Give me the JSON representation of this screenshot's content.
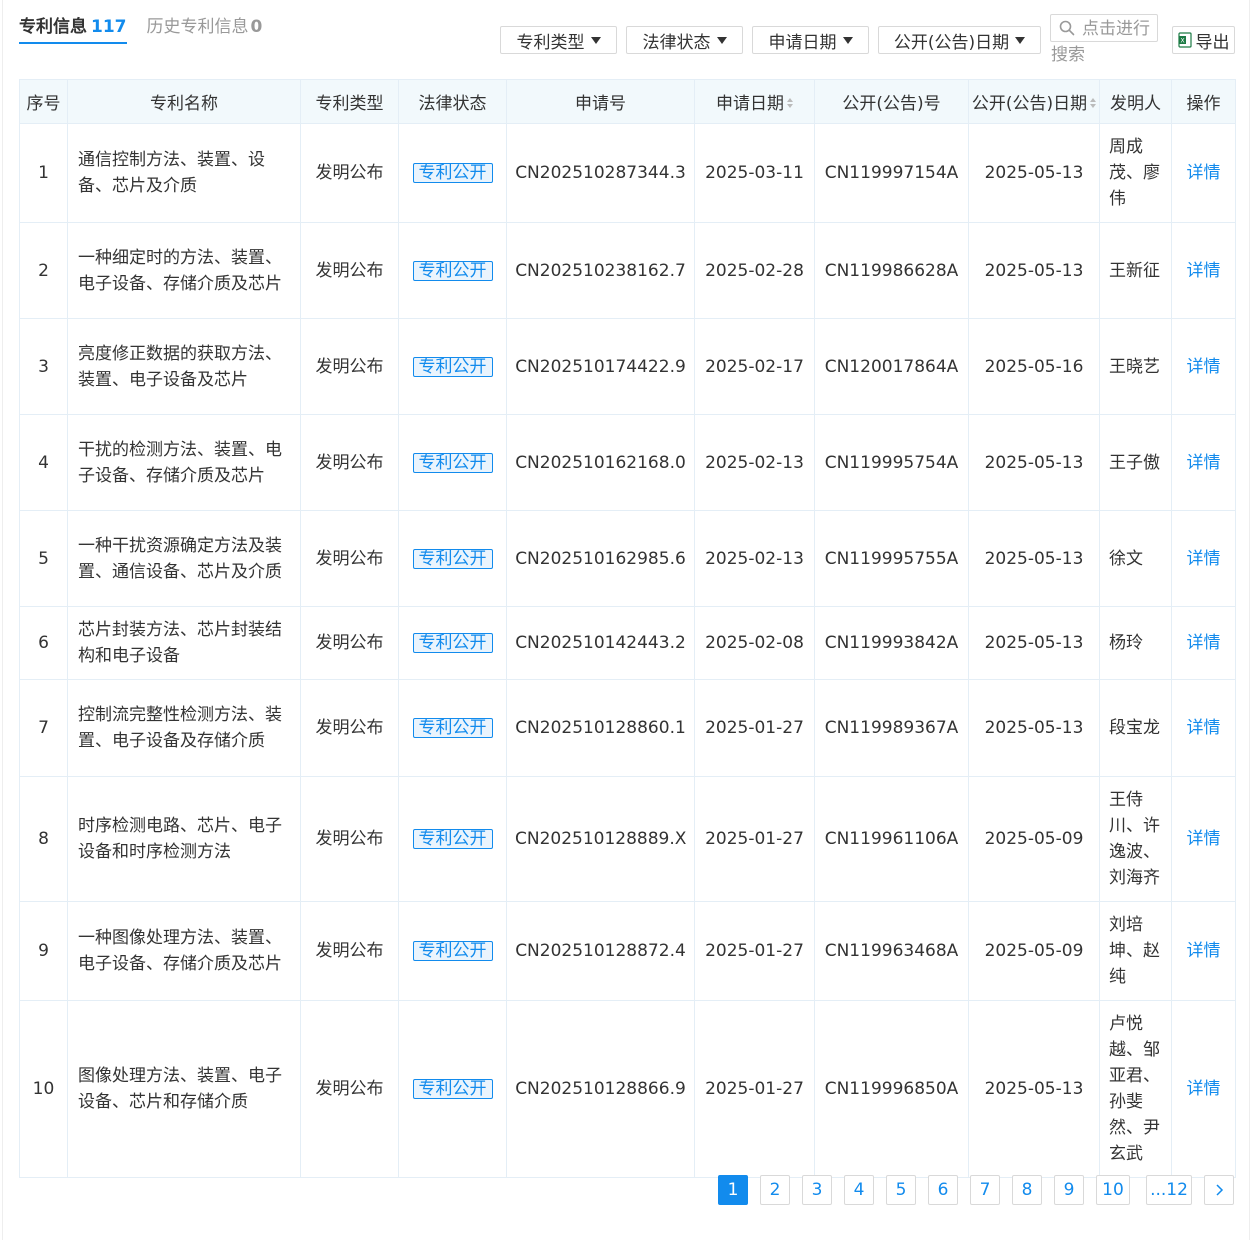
{
  "tabs": {
    "active": {
      "label": "专利信息",
      "count": "117"
    },
    "history": {
      "label": "历史专利信息",
      "count": "0"
    }
  },
  "filters": {
    "patent_type": "专利类型",
    "legal_status": "法律状态",
    "apply_date": "申请日期",
    "pub_date": "公开(公告)日期"
  },
  "search": {
    "line1": "点击进行",
    "line2": "搜索"
  },
  "export_label": "导出",
  "columns": {
    "index": "序号",
    "name": "专利名称",
    "type": "专利类型",
    "status": "法律状态",
    "app_no": "申请号",
    "app_date": "申请日期",
    "pub_no": "公开(公告)号",
    "pub_date": "公开(公告)日期",
    "inventor": "发明人",
    "action": "操作"
  },
  "rows": [
    {
      "index": "1",
      "name": "通信控制方法、装置、设备、芯片及介质",
      "type": "发明公布",
      "status": "专利公开",
      "app_no": "CN202510287344.3",
      "app_date": "2025-03-11",
      "pub_no": "CN119997154A",
      "pub_date": "2025-05-13",
      "inventor": "周成茂、廖伟",
      "action": "详情"
    },
    {
      "index": "2",
      "name": "一种细定时的方法、装置、电子设备、存储介质及芯片",
      "type": "发明公布",
      "status": "专利公开",
      "app_no": "CN202510238162.7",
      "app_date": "2025-02-28",
      "pub_no": "CN119986628A",
      "pub_date": "2025-05-13",
      "inventor": "王新征",
      "action": "详情"
    },
    {
      "index": "3",
      "name": "亮度修正数据的获取方法、装置、电子设备及芯片",
      "type": "发明公布",
      "status": "专利公开",
      "app_no": "CN202510174422.9",
      "app_date": "2025-02-17",
      "pub_no": "CN120017864A",
      "pub_date": "2025-05-16",
      "inventor": "王晓艺",
      "action": "详情"
    },
    {
      "index": "4",
      "name": "干扰的检测方法、装置、电子设备、存储介质及芯片",
      "type": "发明公布",
      "status": "专利公开",
      "app_no": "CN202510162168.0",
      "app_date": "2025-02-13",
      "pub_no": "CN119995754A",
      "pub_date": "2025-05-13",
      "inventor": "王子傲",
      "action": "详情"
    },
    {
      "index": "5",
      "name": "一种干扰资源确定方法及装置、通信设备、芯片及介质",
      "type": "发明公布",
      "status": "专利公开",
      "app_no": "CN202510162985.6",
      "app_date": "2025-02-13",
      "pub_no": "CN119995755A",
      "pub_date": "2025-05-13",
      "inventor": "徐文",
      "action": "详情"
    },
    {
      "index": "6",
      "name": "芯片封装方法、芯片封装结构和电子设备",
      "type": "发明公布",
      "status": "专利公开",
      "app_no": "CN202510142443.2",
      "app_date": "2025-02-08",
      "pub_no": "CN119993842A",
      "pub_date": "2025-05-13",
      "inventor": "杨玲",
      "action": "详情"
    },
    {
      "index": "7",
      "name": "控制流完整性检测方法、装置、电子设备及存储介质",
      "type": "发明公布",
      "status": "专利公开",
      "app_no": "CN202510128860.1",
      "app_date": "2025-01-27",
      "pub_no": "CN119989367A",
      "pub_date": "2025-05-13",
      "inventor": "段宝龙",
      "action": "详情"
    },
    {
      "index": "8",
      "name": "时序检测电路、芯片、电子设备和时序检测方法",
      "type": "发明公布",
      "status": "专利公开",
      "app_no": "CN202510128889.X",
      "app_date": "2025-01-27",
      "pub_no": "CN119961106A",
      "pub_date": "2025-05-09",
      "inventor": "王侍川、许逸波、刘海齐",
      "action": "详情"
    },
    {
      "index": "9",
      "name": "一种图像处理方法、装置、电子设备、存储介质及芯片",
      "type": "发明公布",
      "status": "专利公开",
      "app_no": "CN202510128872.4",
      "app_date": "2025-01-27",
      "pub_no": "CN119963468A",
      "pub_date": "2025-05-09",
      "inventor": "刘培坤、赵纯",
      "action": "详情"
    },
    {
      "index": "10",
      "name": "图像处理方法、装置、电子设备、芯片和存储介质",
      "type": "发明公布",
      "status": "专利公开",
      "app_no": "CN202510128866.9",
      "app_date": "2025-01-27",
      "pub_no": "CN119996850A",
      "pub_date": "2025-05-13",
      "inventor": "卢悦越、邹亚君、孙斐然、尹玄武",
      "action": "详情"
    }
  ],
  "pagination": {
    "pages": [
      "1",
      "2",
      "3",
      "4",
      "5",
      "6",
      "7",
      "8",
      "9",
      "10",
      "...12"
    ],
    "current": "1"
  },
  "colors": {
    "accent": "#128bed",
    "header_bg": "#f2f9fc",
    "border": "#e4eef6"
  }
}
